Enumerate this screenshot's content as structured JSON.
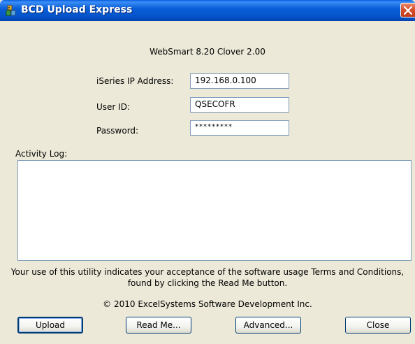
{
  "window": {
    "title": "BCD Upload Express"
  },
  "version_text": "WebSmart 8.20  Clover 2.00",
  "form": {
    "ip_label": "iSeries IP Address:",
    "ip_value": "192.168.0.100",
    "user_label": "User ID:",
    "user_value": "QSECOFR",
    "password_label": "Password:",
    "password_value": "*********"
  },
  "activity_log": {
    "label": "Activity Log:",
    "content": ""
  },
  "notice": {
    "line1": "Your use of this utility indicates your acceptance of the software usage Terms and Conditions,",
    "line2": "found by clicking the Read Me button."
  },
  "copyright": "© 2010 ExcelSystems Software Development Inc.",
  "buttons": {
    "upload": "Upload",
    "readme": "Read Me...",
    "advanced": "Advanced...",
    "close": "Close"
  },
  "icons": {
    "app": "app-icon",
    "close": "close-icon"
  }
}
